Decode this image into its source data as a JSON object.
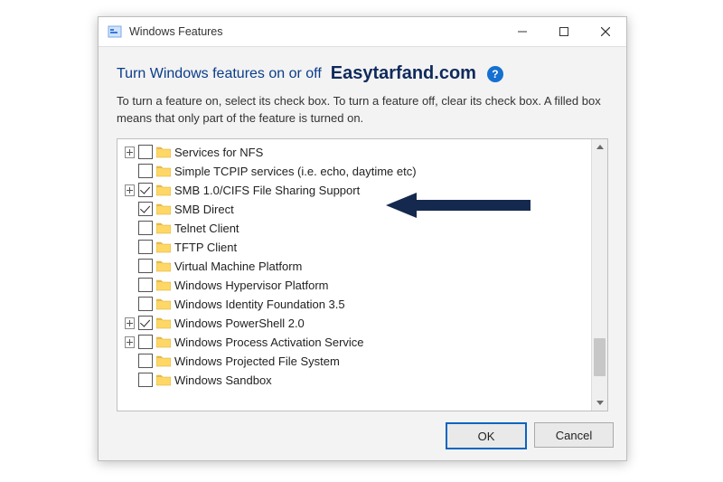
{
  "window": {
    "title": "Windows Features"
  },
  "titlebar": {
    "min_icon": "minimize-icon",
    "max_icon": "maximize-icon",
    "close_icon": "close-icon"
  },
  "heading": "Turn Windows features on or off",
  "brand": "Easytarfand.com",
  "help_glyph": "?",
  "description": "To turn a feature on, select its check box. To turn a feature off, clear its check box. A filled box means that only part of the feature is turned on.",
  "features": [
    {
      "expandable": true,
      "checked": false,
      "label": "Services for NFS"
    },
    {
      "expandable": false,
      "checked": false,
      "label": "Simple TCPIP services (i.e. echo, daytime etc)"
    },
    {
      "expandable": true,
      "checked": true,
      "label": "SMB 1.0/CIFS File Sharing Support"
    },
    {
      "expandable": false,
      "checked": true,
      "label": "SMB Direct"
    },
    {
      "expandable": false,
      "checked": false,
      "label": "Telnet Client"
    },
    {
      "expandable": false,
      "checked": false,
      "label": "TFTP Client"
    },
    {
      "expandable": false,
      "checked": false,
      "label": "Virtual Machine Platform"
    },
    {
      "expandable": false,
      "checked": false,
      "label": "Windows Hypervisor Platform"
    },
    {
      "expandable": false,
      "checked": false,
      "label": "Windows Identity Foundation 3.5"
    },
    {
      "expandable": true,
      "checked": true,
      "label": "Windows PowerShell 2.0"
    },
    {
      "expandable": true,
      "checked": false,
      "label": "Windows Process Activation Service"
    },
    {
      "expandable": false,
      "checked": false,
      "label": "Windows Projected File System"
    },
    {
      "expandable": false,
      "checked": false,
      "label": "Windows Sandbox"
    }
  ],
  "buttons": {
    "ok": "OK",
    "cancel": "Cancel"
  },
  "annotation": {
    "arrow_points_to_index": 2
  }
}
